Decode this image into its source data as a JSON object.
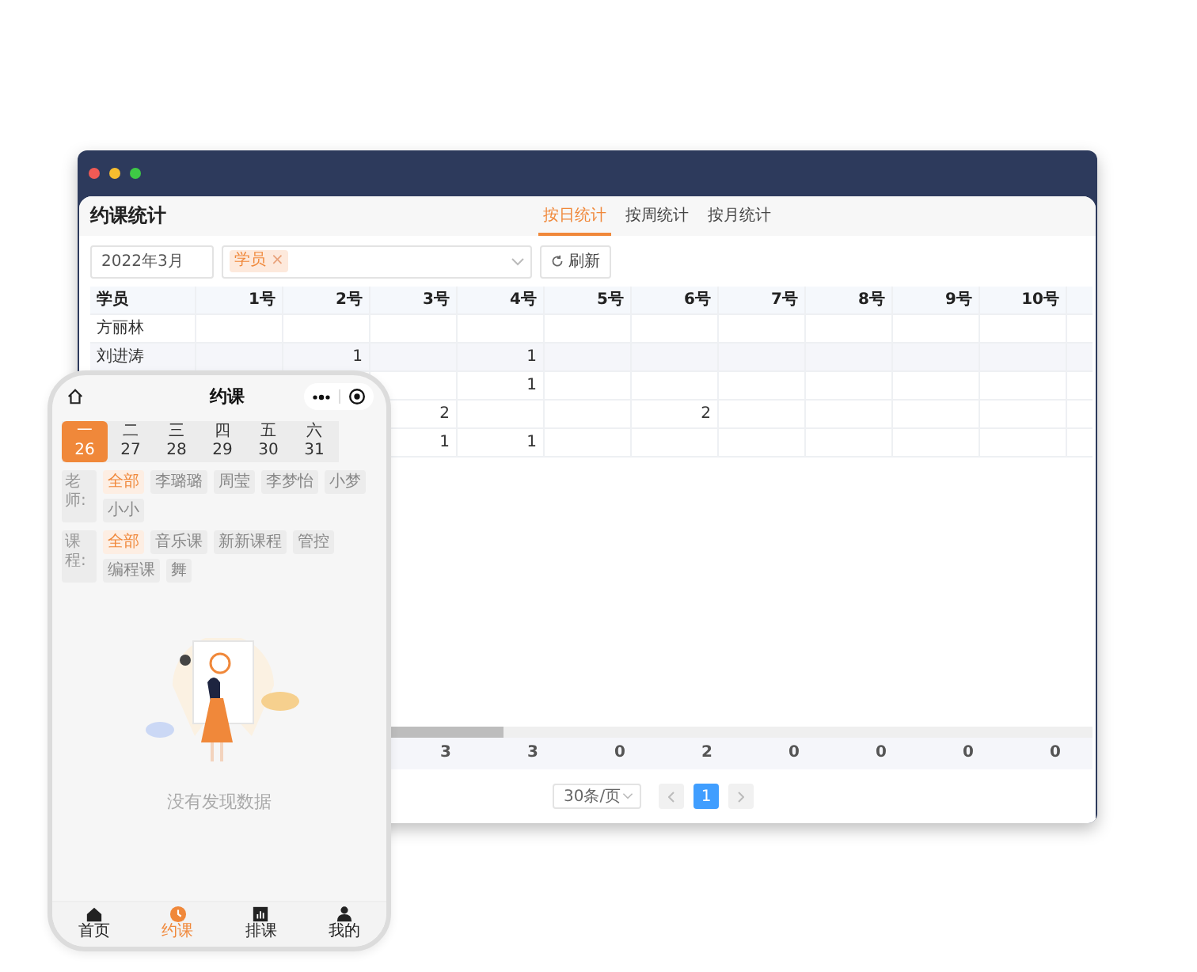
{
  "window": {
    "title": "约课统计",
    "tabs": [
      {
        "label": "按日统计",
        "selected": true
      },
      {
        "label": "按周统计",
        "selected": false
      },
      {
        "label": "按月统计",
        "selected": false
      }
    ]
  },
  "filters": {
    "month": "2022年3月",
    "tags": [
      {
        "label": "学员",
        "remove": "×"
      }
    ],
    "refresh": "刷新"
  },
  "table": {
    "columns": [
      "学员",
      "1号",
      "2号",
      "3号",
      "4号",
      "5号",
      "6号",
      "7号",
      "8号",
      "9号",
      "10号"
    ],
    "rows": [
      {
        "cells": [
          "方丽林",
          null,
          null,
          null,
          null,
          null,
          null,
          null,
          null,
          null,
          null
        ]
      },
      {
        "cells": [
          "刘进涛",
          null,
          "1",
          null,
          "1",
          null,
          null,
          null,
          null,
          null,
          null
        ]
      },
      {
        "cells": [
          null,
          null,
          null,
          null,
          "1",
          null,
          null,
          null,
          null,
          null,
          null
        ]
      },
      {
        "cells": [
          null,
          null,
          null,
          "2",
          null,
          null,
          "2",
          null,
          null,
          null,
          null
        ]
      },
      {
        "cells": [
          null,
          null,
          null,
          "1",
          "1",
          null,
          null,
          null,
          null,
          null,
          null
        ]
      }
    ],
    "summary": [
      "3",
      "3",
      "0",
      "2",
      "0",
      "0",
      "0",
      "0"
    ]
  },
  "pagination": {
    "page_size": "30条/页",
    "pages": [
      {
        "label": "1",
        "selected": true
      }
    ]
  },
  "phone": {
    "title": "约课",
    "days": [
      {
        "weekday": "一",
        "date": "26",
        "selected": true
      },
      {
        "weekday": "二",
        "date": "27",
        "selected": false
      },
      {
        "weekday": "三",
        "date": "28",
        "selected": false
      },
      {
        "weekday": "四",
        "date": "29",
        "selected": false
      },
      {
        "weekday": "五",
        "date": "30",
        "selected": false
      },
      {
        "weekday": "六",
        "date": "31",
        "selected": false
      }
    ],
    "filters": [
      {
        "label": "老师:",
        "options": [
          {
            "label": "全部",
            "selected": true
          },
          {
            "label": "李璐璐",
            "selected": false
          },
          {
            "label": "周莹",
            "selected": false
          },
          {
            "label": "李梦怡",
            "selected": false
          },
          {
            "label": "小梦",
            "selected": false
          },
          {
            "label": "小小",
            "selected": false
          }
        ]
      },
      {
        "label": "课程:",
        "options": [
          {
            "label": "全部",
            "selected": true
          },
          {
            "label": "音乐课",
            "selected": false
          },
          {
            "label": "新新课程",
            "selected": false
          },
          {
            "label": "管控",
            "selected": false
          },
          {
            "label": "编程课",
            "selected": false
          },
          {
            "label": "舞",
            "selected": false
          }
        ]
      }
    ],
    "empty_text": "没有发现数据",
    "tab_bar": [
      {
        "label": "首页",
        "selected": false
      },
      {
        "label": "约课",
        "selected": true
      },
      {
        "label": "排课",
        "selected": false
      },
      {
        "label": "我的",
        "selected": false
      }
    ]
  }
}
